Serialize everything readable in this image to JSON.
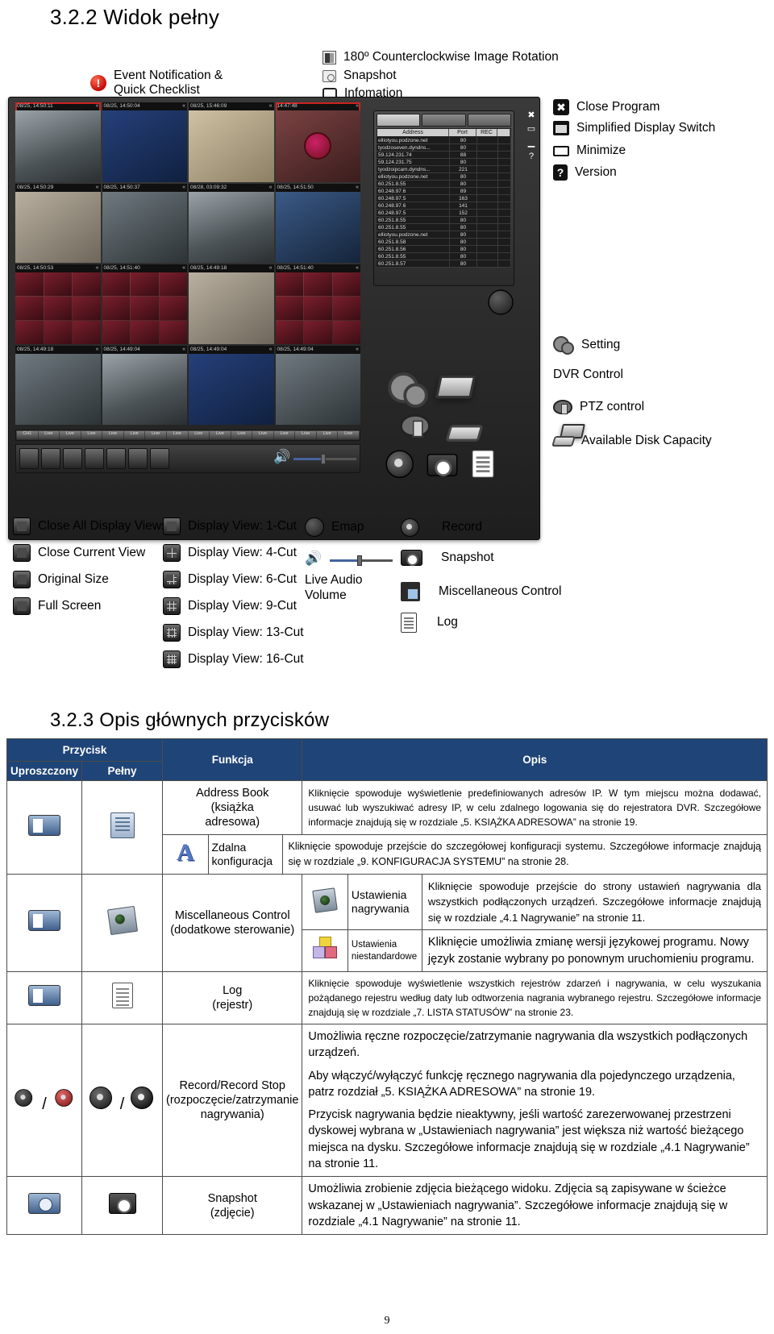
{
  "headings": {
    "section_322": "3.2.2 Widok pełny",
    "section_323": "3.2.3 Opis głównych przycisków"
  },
  "callouts": {
    "event_notification": "Event Notification &\nQuick Checklist",
    "rotation": "180º Counterclockwise Image Rotation",
    "snapshot_top": "Snapshot",
    "information": "Infomation",
    "close_program": "Close Program",
    "simplified_display": "Simplified Display Switch",
    "minimize": "Minimize",
    "version": "Version",
    "setting": "Setting",
    "dvr_control": "DVR Control",
    "ptz_control": "PTZ control",
    "available_disk": "Available Disk Capacity",
    "close_all_views": "Close All Display Views",
    "close_current_view": "Close Current View",
    "original_size": "Original Size",
    "full_screen": "Full Screen",
    "view_1": "Display View: 1-Cut",
    "view_4": "Display View: 4-Cut",
    "view_6": "Display View: 6-Cut",
    "view_9": "Display View: 9-Cut",
    "view_13": "Display View: 13-Cut",
    "view_16": "Display View: 16-Cut",
    "emap": "Emap",
    "live_audio": "Live Audio\nVolume",
    "record": "Record",
    "snapshot": "Snapshot",
    "misc_control": "Miscellaneous Control",
    "log": "Log"
  },
  "dvr_window": {
    "addr_columns": [
      "Address",
      "Port",
      "REC",
      ""
    ],
    "addr_rows": [
      [
        "elliotyou.podzone.net",
        "80",
        "",
        ""
      ],
      [
        "tyodzoseven.dyndns...",
        "80",
        "",
        ""
      ],
      [
        "59.124.231.74",
        "88",
        "",
        ""
      ],
      [
        "59.124.231.75",
        "80",
        "",
        ""
      ],
      [
        "tyodzoipcam.dyndns...",
        "221",
        "",
        ""
      ],
      [
        "elliotyou.podzone.net",
        "80",
        "",
        ""
      ],
      [
        "60.251.8.55",
        "80",
        "",
        ""
      ],
      [
        "60.248.97.6",
        "89",
        "",
        ""
      ],
      [
        "60.248.97.5",
        "163",
        "",
        ""
      ],
      [
        "60.248.97.6",
        "141",
        "",
        ""
      ],
      [
        "60.248.97.5",
        "152",
        "",
        ""
      ],
      [
        "60.251.8.55",
        "80",
        "",
        ""
      ],
      [
        "60.251.8.55",
        "80",
        "",
        ""
      ],
      [
        "elliotyou.podzone.net",
        "80",
        "",
        ""
      ],
      [
        "60.251.8.58",
        "80",
        "",
        ""
      ],
      [
        "60.251.8.56",
        "80",
        "",
        ""
      ],
      [
        "60.251.8.55",
        "80",
        "",
        ""
      ],
      [
        "60.251.8.57",
        "80",
        "",
        ""
      ]
    ],
    "cell_timestamps": [
      "08/25, 14:50:11",
      "08/25, 14:50:04",
      "08/25, 15:46:09",
      "14:47:48",
      "08/25, 14:50:29",
      "08/25, 14:50:37",
      "08/28, 03:09:32",
      "08/25, 14:51:50",
      "08/25, 14:50:53",
      "08/25, 14:51:40",
      "08/25, 14:49:18",
      "08/25, 14:51:40",
      "08/25, 14:49:18",
      "08/25, 14:49:04",
      "08/25, 14:49:04",
      "08/25, 14:49:04"
    ],
    "bottom_buttons": [
      "Live",
      "Live",
      "Live",
      "Live",
      "Live",
      "Live",
      "Live",
      "Live",
      "Live",
      "Live",
      "Live",
      "Live",
      "Live",
      "Live",
      "Live",
      "Live"
    ]
  },
  "table": {
    "header": {
      "przycisk": "Przycisk",
      "uproszczony": "Uproszczony",
      "pelny": "Pełny",
      "funkcja": "Funkcja",
      "opis": "Opis"
    },
    "rows": [
      {
        "function": "Address Book\n(książka\nadresowa)",
        "description": "Kliknięcie spowoduje wyświetlenie predefiniowanych adresów IP. W tym miejscu można dodawać, usuwać lub wyszukiwać adresy IP, w celu zdalnego logowania się do rejestratora DVR. Szczegółowe informacje znajdują się w rozdziale „5. KSIĄŻKA ADRESOWA” na stronie 19."
      },
      {
        "sub_function": "Zdalna konfiguracja",
        "sub_description": "Kliknięcie spowoduje przejście do szczegółowej konfiguracji systemu. Szczegółowe informacje znajdują się w rozdziale „9. KONFIGURACJA SYSTEMU” na stronie 28."
      },
      {
        "function": "Miscellaneous Control\n(dodatkowe sterowanie)",
        "sub1_function": "Ustawienia nagrywania",
        "sub1_description": "Kliknięcie spowoduje przejście do strony ustawień nagrywania dla wszystkich podłączonych urządzeń. Szczegółowe informacje znajdują się w rozdziale „4.1 Nagrywanie” na stronie 11.",
        "sub2_function": "Ustawienia niestandardowe",
        "sub2_description": "Kliknięcie umożliwia zmianę wersji językowej programu. Nowy język zostanie wybrany po ponownym uruchomieniu programu."
      },
      {
        "function": "Log\n(rejestr)",
        "description": "Kliknięcie spowoduje wyświetlenie wszystkich rejestrów zdarzeń i nagrywania, w celu wyszukania pożądanego rejestru według daty lub odtworzenia nagrania wybranego rejestru. Szczegółowe informacje znajdują się w rozdziale „7. LISTA STATUSÓW” na stronie 23."
      },
      {
        "function": "Record/Record Stop\n(rozpoczęcie/zatrzymanie nagrywania)",
        "description_p1": "Umożliwia ręczne rozpoczęcie/zatrzymanie nagrywania dla wszystkich podłączonych urządzeń.",
        "description_p2": "Aby włączyć/wyłączyć funkcję ręcznego nagrywania dla pojedynczego urządzenia, patrz rozdział „5. KSIĄŻKA ADRESOWA” na stronie 19.",
        "description_p3": "Przycisk nagrywania będzie nieaktywny, jeśli wartość zarezerwowanej przestrzeni dyskowej wybrana w „Ustawieniach nagrywania” jest większa niż wartość bieżącego miejsca na dysku. Szczegółowe informacje znajdują się w rozdziale „4.1 Nagrywanie” na stronie 11."
      },
      {
        "function": "Snapshot\n(zdjęcie)",
        "description": "Umożliwia zrobienie zdjęcia bieżącego widoku. Zdjęcia są zapisywane w ścieżce wskazanej w „Ustawieniach nagrywania”. Szczegółowe informacje znajdują się w rozdziale „4.1 Nagrywanie” na stronie 11."
      }
    ]
  },
  "footer": {
    "page_number": "9"
  },
  "colors": {
    "table_header_bg": "#1f4477",
    "accent_blue": "#2d4f9e"
  }
}
